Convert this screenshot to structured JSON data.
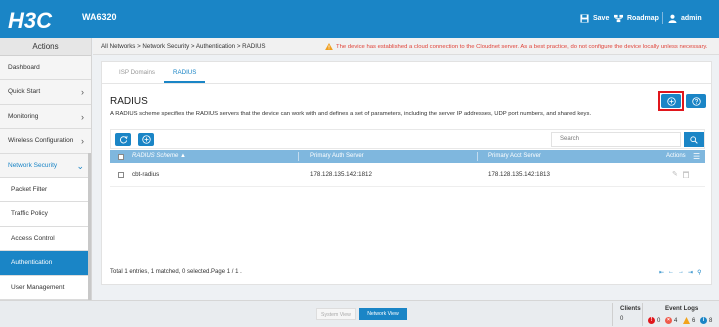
{
  "header": {
    "logo": "H3C",
    "model": "WA6320",
    "save_label": "Save",
    "roadmap_label": "Roadmap",
    "user_label": "admin"
  },
  "sidebar": {
    "title": "Actions",
    "items": [
      {
        "label": "Dashboard"
      },
      {
        "label": "Quick Start"
      },
      {
        "label": "Monitoring"
      },
      {
        "label": "Wireless Configuration"
      },
      {
        "label": "Network Security"
      },
      {
        "label": "Packet Filter"
      },
      {
        "label": "Traffic Policy"
      },
      {
        "label": "Access Control"
      },
      {
        "label": "Authentication"
      },
      {
        "label": "User Management"
      }
    ]
  },
  "breadcrumb": "All Networks > Network Security > Authentication > RADIUS",
  "warning": "The device has established a cloud connection to the Cloudnet server. As a best practice, do not configure the device locally unless necessary.",
  "tabs": [
    {
      "label": "ISP Domains"
    },
    {
      "label": "RADIUS"
    }
  ],
  "page": {
    "title": "RADIUS",
    "description": "A RADIUS scheme specifies the RADIUS servers that the device can work with and defines a set of parameters, including the server IP addresses, UDP port numbers, and shared keys."
  },
  "search": {
    "placeholder": "Search"
  },
  "table": {
    "columns": [
      "RADIUS Scheme",
      "Primary Auth Server",
      "Primary Acct Server",
      "Actions"
    ],
    "rows": [
      {
        "scheme": "cbt-radius",
        "auth": "178.128.135.142:1812",
        "acct": "178.128.135.142:1813"
      }
    ]
  },
  "table_footer": "Total 1 entries, 1 matched, 0 selected.Page 1 / 1 .",
  "statusbar": {
    "system_view": "System View",
    "network_view": "Network View",
    "clients_label": "Clients",
    "clients_value": "0",
    "event_logs_label": "Event Logs",
    "logs": {
      "critical": "0",
      "error": "4",
      "warning": "6",
      "info": "8"
    }
  },
  "colors": {
    "accent": "#1a85c6",
    "highlight": "#e0161c",
    "warning_text": "#e0443a"
  }
}
